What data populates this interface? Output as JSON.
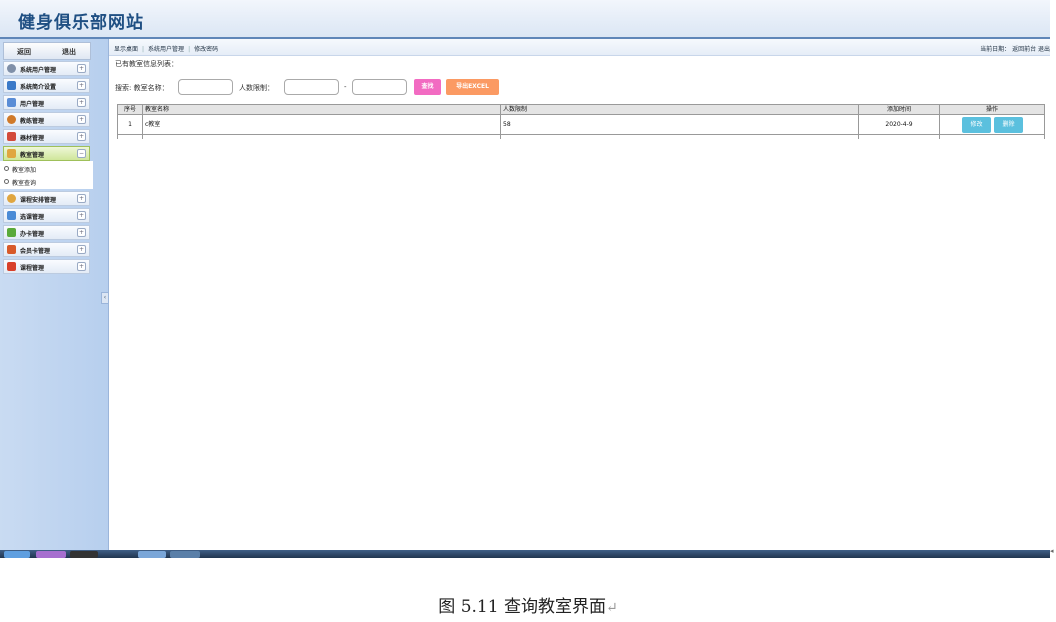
{
  "header": {
    "title": "健身俱乐部网站"
  },
  "sidebar": {
    "back_label": "返回",
    "logout_label": "退出",
    "menu": [
      {
        "label": "系统用户管理",
        "color": "#7f8fa8"
      },
      {
        "label": "系统简介设置",
        "color": "#3a79c8"
      },
      {
        "label": "用户管理",
        "color": "#5a8dd6"
      },
      {
        "label": "教练管理",
        "color": "#d07a2a"
      },
      {
        "label": "器材管理",
        "color": "#d34a3a"
      },
      {
        "label": "教室管理",
        "color": "#e0a640",
        "active": true
      }
    ],
    "submenu": [
      "教室添加",
      "教室查询"
    ],
    "menu_after": [
      {
        "label": "课程安排管理",
        "color": "#e0a640"
      },
      {
        "label": "选课管理",
        "color": "#4a8bd6"
      },
      {
        "label": "办卡管理",
        "color": "#5aaa3a"
      },
      {
        "label": "会员卡管理",
        "color": "#d85a2a"
      },
      {
        "label": "课程管理",
        "color": "#d8402a"
      }
    ],
    "plus": "+",
    "minus": "−",
    "collapse_glyph": "‹"
  },
  "topnav": {
    "links": [
      "显示桌面",
      "系统用户管理",
      "修改密码"
    ],
    "right": "当前日期： 返回前台 退出"
  },
  "content": {
    "list_title": "已有教室信息列表：",
    "search_label": "搜索: 教室名称：",
    "limit_label": "人数限制：",
    "dash": "-",
    "find_button": "查找",
    "excel_button": "导出EXCEL"
  },
  "table": {
    "headers": [
      "序号",
      "教室名称",
      "人数限制",
      "添加时间",
      "操作"
    ],
    "rows": [
      {
        "index": "1",
        "name": "c教室",
        "limit": "58",
        "added": "2020-4-9"
      }
    ],
    "edit_label": "修改",
    "delete_label": "删除"
  },
  "caption": {
    "text": "图 5.11 查询教室界面",
    "return_mark": "↵"
  }
}
